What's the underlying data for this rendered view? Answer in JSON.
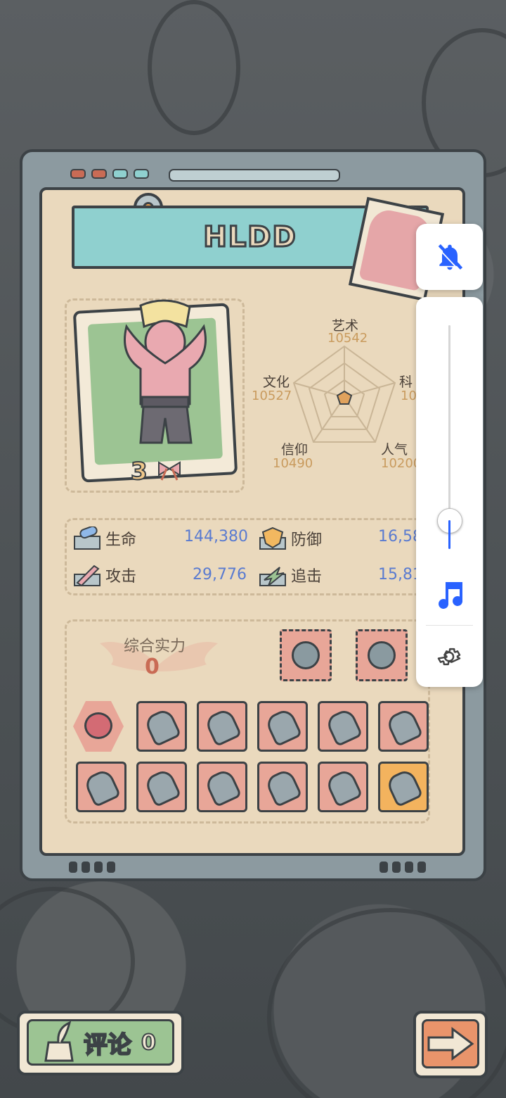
{
  "player": {
    "name": "HLDD",
    "level": "3"
  },
  "attributes": {
    "art": {
      "label": "艺术",
      "value": "10542"
    },
    "culture": {
      "label": "文化",
      "value": "10527"
    },
    "science": {
      "label": "科",
      "value": "10"
    },
    "faith": {
      "label": "信仰",
      "value": "10490"
    },
    "popularity": {
      "label": "人气",
      "value": "10200"
    }
  },
  "stats": {
    "hp": {
      "label": "生命",
      "value": "144,380"
    },
    "defense": {
      "label": "防御",
      "value": "16,58"
    },
    "attack": {
      "label": "攻击",
      "value": "29,776"
    },
    "pursuit": {
      "label": "追击",
      "value": "15,81"
    }
  },
  "power": {
    "label": "综合实力",
    "value": "0"
  },
  "comment": {
    "label": "评论",
    "count": "0"
  },
  "colors": {
    "accent_blue": "#2962ff",
    "panel_bg": "#ead9bd",
    "teal": "#8fd0cf",
    "green": "#9cc493"
  },
  "overlay": {
    "volume_level": 0.13,
    "icons": [
      "bell-off-icon",
      "music-note-icon",
      "settings-gear-icon"
    ]
  }
}
